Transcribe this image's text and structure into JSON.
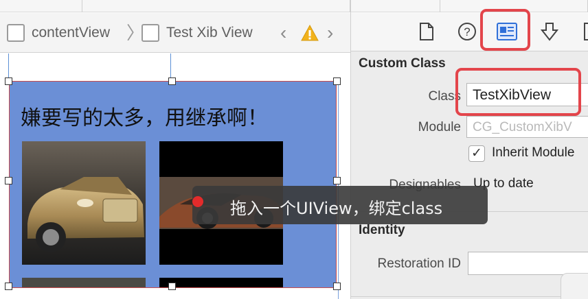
{
  "breadcrumb": {
    "items": [
      {
        "label": "contentView"
      },
      {
        "label": "Test Xib View"
      }
    ]
  },
  "canvas": {
    "view_title": "嫌要写的太多，用继承啊！"
  },
  "inspector": {
    "tabs": [
      {
        "icon": "file-icon"
      },
      {
        "icon": "help-icon"
      },
      {
        "icon": "identity-inspector-icon"
      },
      {
        "icon": "attributes-icon"
      },
      {
        "icon": "size-icon"
      }
    ],
    "custom_class": {
      "title": "Custom Class",
      "class_label": "Class",
      "class_value": "TestXibView",
      "module_label": "Module",
      "module_placeholder": "CG_CustomXibV",
      "inherit_label": "Inherit Module",
      "designables_label": "Designables",
      "designables_value": "Up to date"
    },
    "identity": {
      "title": "Identity",
      "restoration_label": "Restoration ID",
      "restoration_value": ""
    }
  },
  "tooltip": {
    "text": "拖入一个UIView，绑定class"
  },
  "colors": {
    "highlight": "#e3454b",
    "view_background": "#6b8fd6",
    "selection_guide": "#5b8fd6"
  }
}
